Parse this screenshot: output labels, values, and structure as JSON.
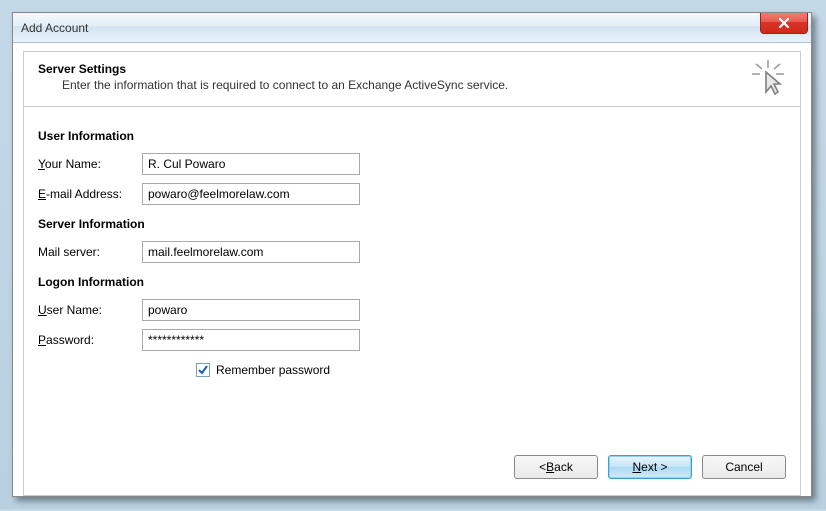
{
  "window": {
    "title": "Add Account"
  },
  "header": {
    "title": "Server Settings",
    "description": "Enter the information that is required to connect to an Exchange ActiveSync service."
  },
  "sections": {
    "user_info_title": "User Information",
    "server_info_title": "Server Information",
    "logon_info_title": "Logon Information"
  },
  "labels": {
    "your_name_pre": "Y",
    "your_name_rest": "our Name:",
    "email_pre": "E",
    "email_rest": "-mail Address:",
    "mail_server": "Mail server:",
    "user_name_pre": "U",
    "user_name_rest": "ser Name:",
    "password_pre": "P",
    "password_rest": "assword:",
    "remember_pre": "R",
    "remember_rest": "emember password"
  },
  "values": {
    "your_name": "R. Cul Powaro",
    "email": "powaro@feelmorelaw.com",
    "mail_server": "mail.feelmorelaw.com",
    "user_name": "powaro",
    "password": "************",
    "remember_checked": true
  },
  "buttons": {
    "back": "< Back",
    "next_pre": "N",
    "next_rest": "ext >",
    "cancel": "Cancel"
  }
}
